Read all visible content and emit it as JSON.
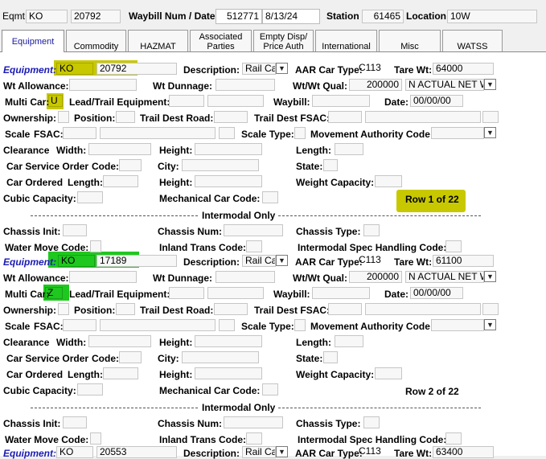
{
  "header": {
    "eqmt_label": "Eqmt",
    "eqmt_initial": "KO",
    "eqmt_number": "20792",
    "waybill_label": "Waybill Num / Date",
    "waybill_num": "512771",
    "waybill_date": "8/13/24",
    "station_label": "Station",
    "station_value": "61465",
    "location_label": "Location",
    "location_value": "10W"
  },
  "tabs": [
    {
      "label": "Equipment"
    },
    {
      "label": "Commodity"
    },
    {
      "label": "HAZMAT"
    },
    {
      "label": "Associated\nParties"
    },
    {
      "label": "Empty Disp/\nPrice Auth"
    },
    {
      "label": "International"
    },
    {
      "label": "Misc"
    },
    {
      "label": "WATSS"
    }
  ],
  "labels": {
    "equipment": "Equipment:",
    "description": "Description:",
    "aar_car_type": "AAR Car Type:",
    "tare_wt": "Tare Wt:",
    "wt_allowance": "Wt Allowance:",
    "wt_dunnage": "Wt Dunnage:",
    "wt_qual": "Wt/Wt Qual:",
    "multi_car": "Multi Car:",
    "lead_trail": "Lead/Trail Equipment:",
    "waybill": "Waybill:",
    "date": "Date:",
    "ownership": "Ownership:",
    "position": "Position:",
    "trail_dest_road": "Trail Dest Road:",
    "trail_dest_fsac": "Trail Dest FSAC:",
    "scale": "Scale",
    "fsac": "FSAC:",
    "scale_type": "Scale Type:",
    "movement_authority_code": "Movement Authority Code:",
    "clearance": "Clearance",
    "width": "Width:",
    "height": "Height:",
    "length": "Length:",
    "car_service_order": "Car Service Order",
    "code": "Code:",
    "city": "City:",
    "state": "State:",
    "car_ordered": "Car Ordered",
    "length2": "Length:",
    "weight_capacity": "Weight Capacity:",
    "cubic_capacity": "Cubic Capacity:",
    "mechanical_car_code": "Mechanical Car Code:",
    "intermodal_only": "Intermodal Only",
    "chassis_init": "Chassis Init:",
    "chassis_num": "Chassis Num:",
    "chassis_type": "Chassis Type:",
    "water_move_code": "Water Move Code:",
    "inland_trans_code": "Inland Trans Code:",
    "intermodal_spec_handling": "Intermodal Spec Handling Code:"
  },
  "records": [
    {
      "equip_initial": "KO",
      "equip_number": "20792",
      "description": "Rail Ca",
      "aar_car_type": "C113",
      "tare_wt": "64000",
      "wt_qual_value": "200000",
      "wt_qual_type": "N ACTUAL NET W",
      "multi_car": "U",
      "date": "00/00/00",
      "row_indicator": "Row 1 of 22"
    },
    {
      "equip_initial": "KO",
      "equip_number": "17189",
      "description": "Rail Ca",
      "aar_car_type": "C113",
      "tare_wt": "61100",
      "wt_qual_value": "200000",
      "wt_qual_type": "N ACTUAL NET W",
      "multi_car": "Z",
      "date": "00/00/00",
      "row_indicator": "Row 2 of 22"
    },
    {
      "equip_initial": "KO",
      "equip_number": "20553",
      "description": "Rail Ca",
      "aar_car_type": "C113",
      "tare_wt": "63400"
    }
  ],
  "colors": {
    "highlight_yellow": "#c8c800",
    "highlight_green": "#1ec81e",
    "equipment_label": "#1a1ab4"
  }
}
